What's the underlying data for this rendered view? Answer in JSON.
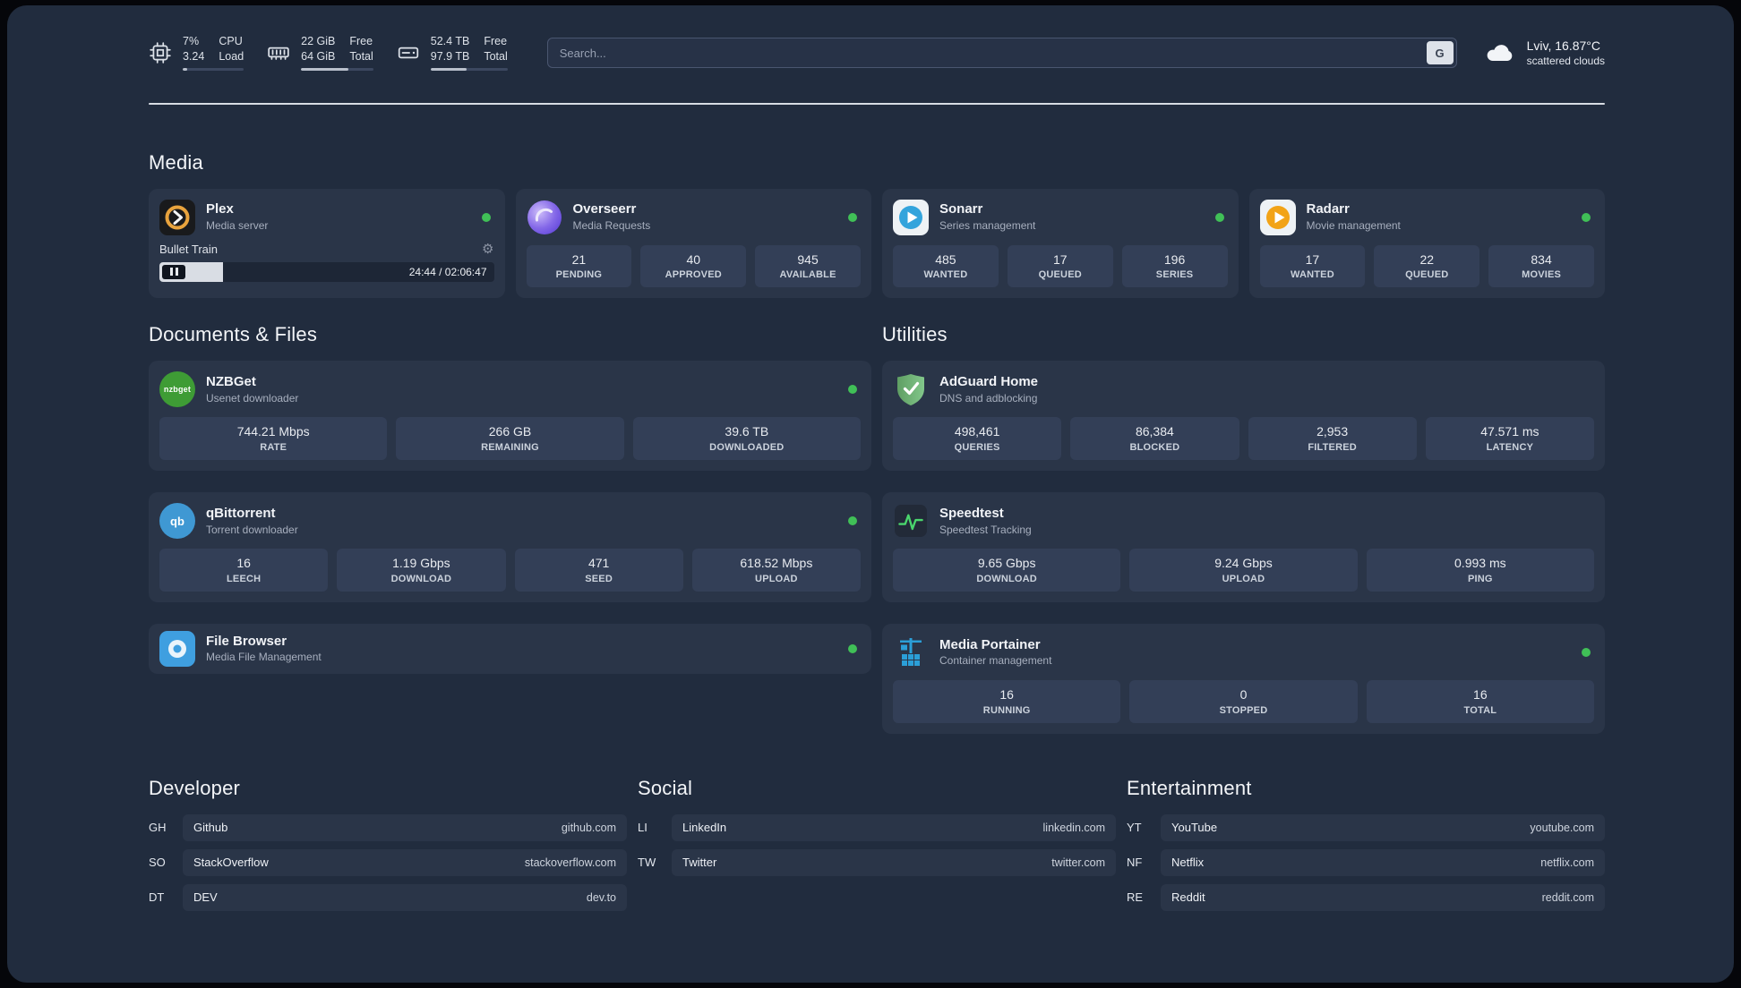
{
  "colors": {
    "status_online": "#40c057",
    "accent_green": "#4ad66d",
    "panel_bg": "#212c3e",
    "card_bg": "#2a3548"
  },
  "icons": {
    "nzbget_text": "nzbget",
    "qb_text": "qb",
    "gear": "⚙"
  },
  "topbar": {
    "cpu": {
      "value": "7%",
      "sub": "3.24",
      "label_top": "CPU",
      "label_bottom": "Load",
      "percent": 7
    },
    "memory": {
      "value": "22 GiB",
      "sub": "64 GiB",
      "label_top": "Free",
      "label_bottom": "Total",
      "percent": 66
    },
    "disk": {
      "value": "52.4 TB",
      "sub": "97.9 TB",
      "label_top": "Free",
      "label_bottom": "Total",
      "percent": 47
    },
    "search": {
      "placeholder": "Search...",
      "shortcut": "G"
    },
    "weather": {
      "location": "Lviv, 16.87°C",
      "condition": "scattered clouds"
    }
  },
  "sections": {
    "media": {
      "title": "Media",
      "plex": {
        "name": "Plex",
        "subtitle": "Media server",
        "now_playing": "Bullet Train",
        "time": "24:44 / 02:06:47",
        "progress_percent": 19
      },
      "overseerr": {
        "name": "Overseerr",
        "subtitle": "Media Requests",
        "stats": [
          {
            "value": "21",
            "label": "PENDING"
          },
          {
            "value": "40",
            "label": "APPROVED"
          },
          {
            "value": "945",
            "label": "AVAILABLE"
          }
        ]
      },
      "sonarr": {
        "name": "Sonarr",
        "subtitle": "Series management",
        "stats": [
          {
            "value": "485",
            "label": "WANTED"
          },
          {
            "value": "17",
            "label": "QUEUED"
          },
          {
            "value": "196",
            "label": "SERIES"
          }
        ]
      },
      "radarr": {
        "name": "Radarr",
        "subtitle": "Movie management",
        "stats": [
          {
            "value": "17",
            "label": "WANTED"
          },
          {
            "value": "22",
            "label": "QUEUED"
          },
          {
            "value": "834",
            "label": "MOVIES"
          }
        ]
      }
    },
    "documents": {
      "title": "Documents & Files",
      "nzbget": {
        "name": "NZBGet",
        "subtitle": "Usenet downloader",
        "stats": [
          {
            "value": "744.21 Mbps",
            "label": "RATE"
          },
          {
            "value": "266 GB",
            "label": "REMAINING"
          },
          {
            "value": "39.6 TB",
            "label": "DOWNLOADED"
          }
        ]
      },
      "qbittorrent": {
        "name": "qBittorrent",
        "subtitle": "Torrent downloader",
        "stats": [
          {
            "value": "16",
            "label": "LEECH"
          },
          {
            "value": "1.19 Gbps",
            "label": "DOWNLOAD"
          },
          {
            "value": "471",
            "label": "SEED"
          },
          {
            "value": "618.52 Mbps",
            "label": "UPLOAD"
          }
        ]
      },
      "filebrowser": {
        "name": "File Browser",
        "subtitle": "Media File Management"
      }
    },
    "utilities": {
      "title": "Utilities",
      "adguard": {
        "name": "AdGuard Home",
        "subtitle": "DNS and adblocking",
        "stats": [
          {
            "value": "498,461",
            "label": "QUERIES"
          },
          {
            "value": "86,384",
            "label": "BLOCKED"
          },
          {
            "value": "2,953",
            "label": "FILTERED"
          },
          {
            "value": "47.571 ms",
            "label": "LATENCY"
          }
        ]
      },
      "speedtest": {
        "name": "Speedtest",
        "subtitle": "Speedtest Tracking",
        "stats": [
          {
            "value": "9.65 Gbps",
            "label": "DOWNLOAD"
          },
          {
            "value": "9.24 Gbps",
            "label": "UPLOAD"
          },
          {
            "value": "0.993 ms",
            "label": "PING"
          }
        ]
      },
      "portainer": {
        "name": "Media Portainer",
        "subtitle": "Container management",
        "stats": [
          {
            "value": "16",
            "label": "RUNNING"
          },
          {
            "value": "0",
            "label": "STOPPED"
          },
          {
            "value": "16",
            "label": "TOTAL"
          }
        ]
      }
    },
    "developer": {
      "title": "Developer",
      "links": [
        {
          "tag": "GH",
          "name": "Github",
          "url": "github.com"
        },
        {
          "tag": "SO",
          "name": "StackOverflow",
          "url": "stackoverflow.com"
        },
        {
          "tag": "DT",
          "name": "DEV",
          "url": "dev.to"
        }
      ]
    },
    "social": {
      "title": "Social",
      "links": [
        {
          "tag": "LI",
          "name": "LinkedIn",
          "url": "linkedin.com"
        },
        {
          "tag": "TW",
          "name": "Twitter",
          "url": "twitter.com"
        }
      ]
    },
    "entertainment": {
      "title": "Entertainment",
      "links": [
        {
          "tag": "YT",
          "name": "YouTube",
          "url": "youtube.com"
        },
        {
          "tag": "NF",
          "name": "Netflix",
          "url": "netflix.com"
        },
        {
          "tag": "RE",
          "name": "Reddit",
          "url": "reddit.com"
        }
      ]
    }
  }
}
